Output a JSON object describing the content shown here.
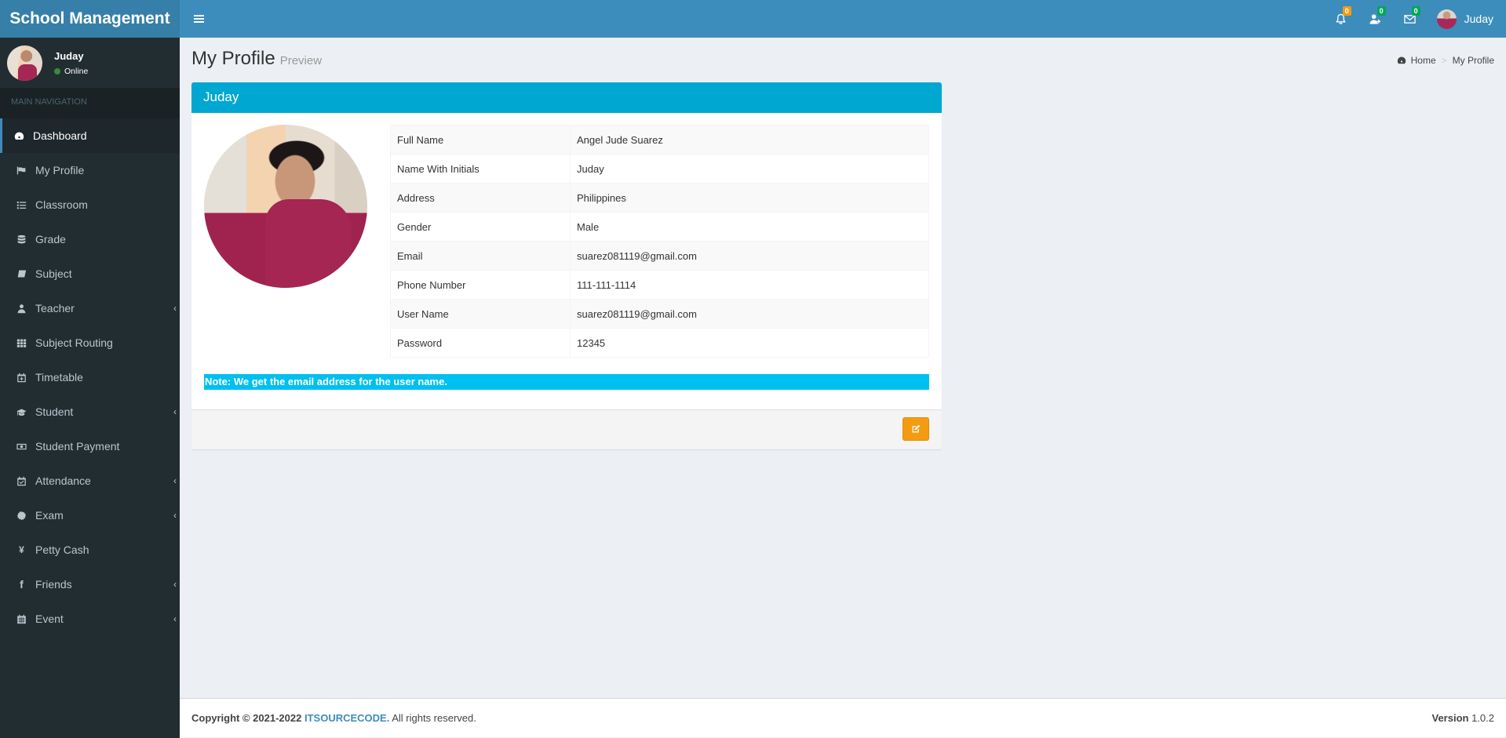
{
  "app": {
    "title": "School Management"
  },
  "header": {
    "notifications": {
      "icon": "bell-icon",
      "count": "0",
      "color": "#f39c12"
    },
    "friend_requests": {
      "icon": "user-plus-icon",
      "count": "0",
      "color": "#00a65a"
    },
    "messages": {
      "icon": "envelope-icon",
      "count": "0",
      "color": "#00a65a"
    },
    "user_name": "Juday"
  },
  "sidebar": {
    "user": {
      "name": "Juday",
      "status": "Online"
    },
    "section_header": "MAIN NAVIGATION",
    "items": [
      {
        "label": "Dashboard",
        "icon": "dashboard-icon",
        "active": true,
        "has_submenu": false
      },
      {
        "label": "My Profile",
        "icon": "flag-icon",
        "active": false,
        "has_submenu": false
      },
      {
        "label": "Classroom",
        "icon": "list-icon",
        "active": false,
        "has_submenu": false
      },
      {
        "label": "Grade",
        "icon": "database-icon",
        "active": false,
        "has_submenu": false
      },
      {
        "label": "Subject",
        "icon": "book-icon",
        "active": false,
        "has_submenu": false
      },
      {
        "label": "Teacher",
        "icon": "user-icon",
        "active": false,
        "has_submenu": true
      },
      {
        "label": "Subject Routing",
        "icon": "grid-icon",
        "active": false,
        "has_submenu": false
      },
      {
        "label": "Timetable",
        "icon": "calendar-plus-icon",
        "active": false,
        "has_submenu": false
      },
      {
        "label": "Student",
        "icon": "graduation-cap-icon",
        "active": false,
        "has_submenu": true
      },
      {
        "label": "Student Payment",
        "icon": "money-icon",
        "active": false,
        "has_submenu": false
      },
      {
        "label": "Attendance",
        "icon": "calendar-check-icon",
        "active": false,
        "has_submenu": true
      },
      {
        "label": "Exam",
        "icon": "certificate-icon",
        "active": false,
        "has_submenu": true
      },
      {
        "label": "Petty Cash",
        "icon": "yen-icon",
        "active": false,
        "has_submenu": false
      },
      {
        "label": "Friends",
        "icon": "facebook-icon",
        "active": false,
        "has_submenu": true
      },
      {
        "label": "Event",
        "icon": "calendar-icon",
        "active": false,
        "has_submenu": true
      }
    ]
  },
  "page": {
    "title": "My Profile",
    "subtitle": "Preview",
    "breadcrumb": [
      {
        "label": "Home",
        "icon": "dashboard-icon"
      },
      {
        "label": "My Profile"
      }
    ]
  },
  "profile": {
    "box_title": "Juday",
    "fields": [
      {
        "label": "Full Name",
        "value": "Angel Jude Suarez"
      },
      {
        "label": "Name With Initials",
        "value": "Juday"
      },
      {
        "label": "Address",
        "value": "Philippines"
      },
      {
        "label": "Gender",
        "value": "Male"
      },
      {
        "label": "Email",
        "value": "suarez081119@gmail.com"
      },
      {
        "label": "Phone Number",
        "value": "111-111-1114"
      },
      {
        "label": "User Name",
        "value": "suarez081119@gmail.com"
      },
      {
        "label": "Password",
        "value": "12345"
      }
    ],
    "note": "Note: We get the email address for the user name.",
    "edit_button": {
      "icon": "edit-icon",
      "color": "#f39c12"
    }
  },
  "footer": {
    "copyright_prefix": "Copyright © 2021-2022",
    "brand": "ITSOURCECODE.",
    "copyright_suffix": " All rights reserved.",
    "version_label": "Version",
    "version_value": "1.0.2"
  },
  "colors": {
    "header": "#3c8dbc",
    "logo": "#367fa9",
    "sidebar": "#222d32",
    "box_header": "#00a7d0",
    "note": "#00c0ef"
  }
}
